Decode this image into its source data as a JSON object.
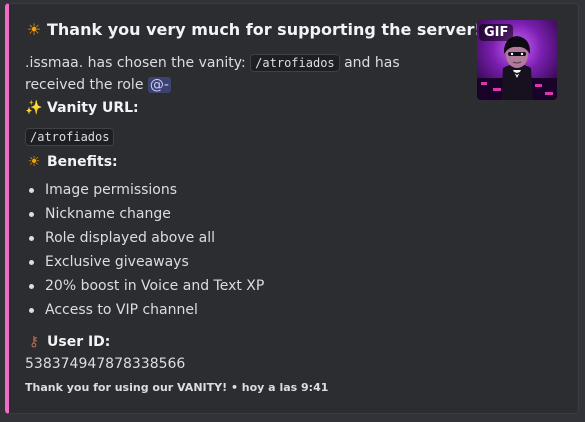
{
  "embed": {
    "accent_color": "#f06ec8",
    "title_emoji": "sun-emoji",
    "title": "Thank you very much for supporting the server!",
    "description": {
      "prefix": ".issmaa. has chosen the vanity: ",
      "vanity_code": "/atrofiados",
      "middle": " and has received the role ",
      "role_mention": "@-"
    },
    "vanity_section": {
      "emoji": "sparkles-emoji",
      "heading": "Vanity URL:",
      "value": "/atrofiados"
    },
    "benefits_section": {
      "emoji": "sun-emoji",
      "heading": "Benefits:",
      "items": [
        "Image permissions",
        "Nickname change",
        "Role displayed above all",
        "Exclusive giveaways",
        "20% boost in Voice and Text XP",
        "Access to VIP channel"
      ]
    },
    "user_id_section": {
      "emoji": "key-emoji",
      "heading": "User ID:",
      "value": "538374947878338566"
    },
    "footer": "Thank you for using our VANITY! • hoy a las 9:41",
    "thumbnail": {
      "badge": "GIF"
    }
  }
}
